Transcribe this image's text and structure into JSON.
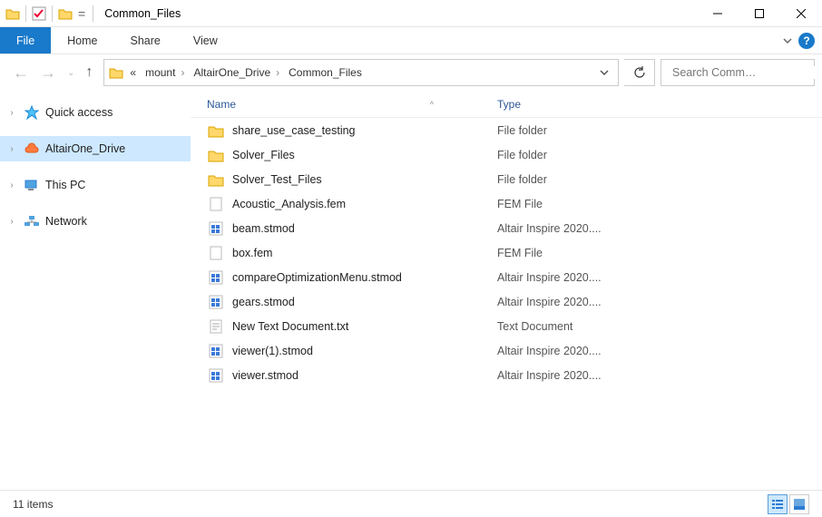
{
  "window": {
    "title": "Common_Files",
    "minimize": "—",
    "maximize": "□",
    "close": "✕"
  },
  "ribbon": {
    "file": "File",
    "tabs": [
      "Home",
      "Share",
      "View"
    ]
  },
  "nav": {
    "back": "←",
    "forward": "→",
    "recent_chev": "⌄",
    "up": "↑"
  },
  "address": {
    "overflow": "«",
    "crumbs": [
      "mount",
      "AltairOne_Drive",
      "Common_Files"
    ],
    "dropdown": "⌄",
    "refresh": "⟳"
  },
  "search": {
    "placeholder": "Search Comm…"
  },
  "navpane": {
    "items": [
      {
        "label": "Quick access",
        "icon": "star",
        "expander": "›"
      },
      {
        "label": "AltairOne_Drive",
        "icon": "cloud",
        "expander": "›",
        "selected": true
      },
      {
        "label": "This PC",
        "icon": "pc",
        "expander": "›"
      },
      {
        "label": "Network",
        "icon": "network",
        "expander": "›"
      }
    ]
  },
  "columns": {
    "name": "Name",
    "type": "Type",
    "sort": "^"
  },
  "files": [
    {
      "name": "share_use_case_testing",
      "type": "File folder",
      "icon": "folder"
    },
    {
      "name": "Solver_Files",
      "type": "File folder",
      "icon": "folder"
    },
    {
      "name": "Solver_Test_Files",
      "type": "File folder",
      "icon": "folder"
    },
    {
      "name": "Acoustic_Analysis.fem",
      "type": "FEM File",
      "icon": "file"
    },
    {
      "name": "beam.stmod",
      "type": "Altair Inspire 2020....",
      "icon": "stmod"
    },
    {
      "name": "box.fem",
      "type": "FEM File",
      "icon": "file"
    },
    {
      "name": "compareOptimizationMenu.stmod",
      "type": "Altair Inspire 2020....",
      "icon": "stmod"
    },
    {
      "name": "gears.stmod",
      "type": "Altair Inspire 2020....",
      "icon": "stmod"
    },
    {
      "name": "New Text Document.txt",
      "type": "Text Document",
      "icon": "txt"
    },
    {
      "name": "viewer(1).stmod",
      "type": "Altair Inspire 2020....",
      "icon": "stmod"
    },
    {
      "name": "viewer.stmod",
      "type": "Altair Inspire 2020....",
      "icon": "stmod"
    }
  ],
  "status": {
    "count": "11 items"
  }
}
